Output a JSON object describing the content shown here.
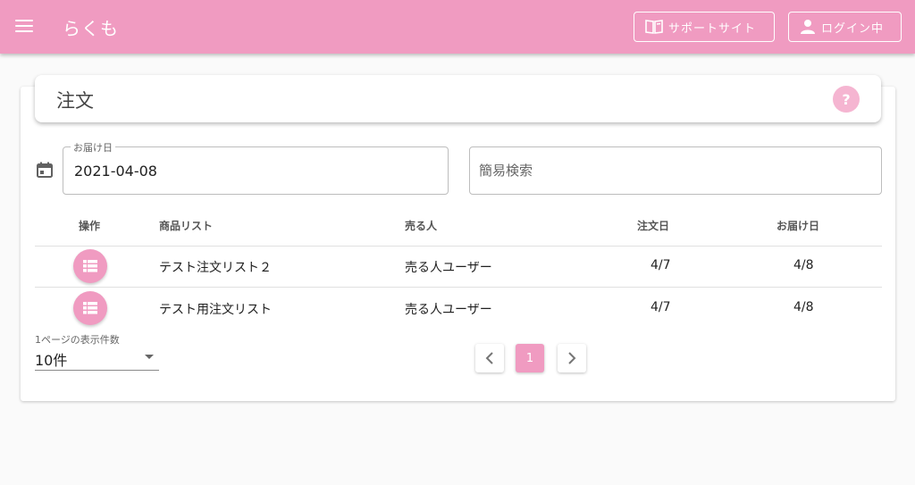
{
  "app": {
    "title": "らくも"
  },
  "header": {
    "support_label": "サポートサイト",
    "login_label": "ログイン中"
  },
  "page": {
    "title": "注文",
    "help_label": "?"
  },
  "filters": {
    "date_label": "お届け日",
    "date_value": "2021-04-08",
    "search_placeholder": "簡易検索"
  },
  "table": {
    "columns": [
      "操作",
      "商品リスト",
      "売る人",
      "注文日",
      "お届け日"
    ],
    "rows": [
      {
        "list": "テスト注文リスト２",
        "seller": "売る人ユーザー",
        "order_date": "4/7",
        "delivery_date": "4/8"
      },
      {
        "list": "テスト用注文リスト",
        "seller": "売る人ユーザー",
        "order_date": "4/7",
        "delivery_date": "4/8"
      }
    ]
  },
  "pagination": {
    "per_page_label": "1ページの表示件数",
    "per_page_value": "10件",
    "current_page": "1"
  },
  "colors": {
    "primary": "#f09bc1",
    "help": "#f5b5d1"
  }
}
